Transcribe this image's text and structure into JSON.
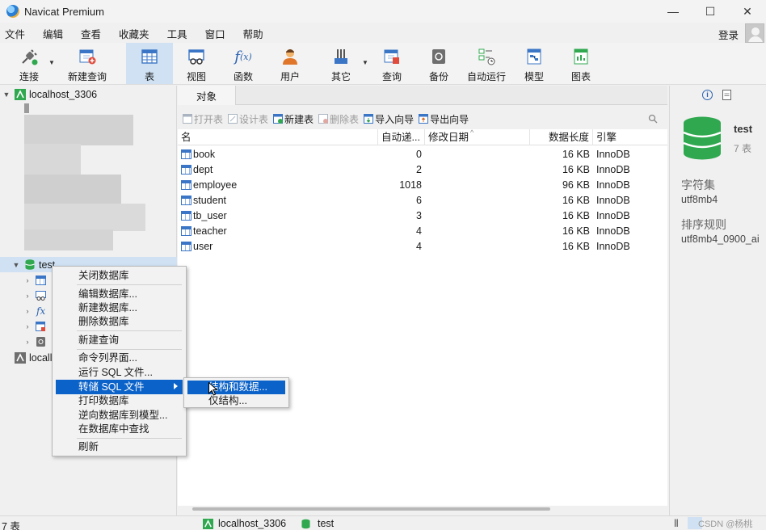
{
  "window": {
    "title": "Navicat Premium",
    "minimize": "—",
    "maximize": "☐",
    "close": "✕"
  },
  "menubar": {
    "items": [
      "文件",
      "编辑",
      "查看",
      "收藏夹",
      "工具",
      "窗口",
      "帮助"
    ],
    "login": "登录"
  },
  "toolbar": {
    "connect": "连接",
    "new_query": "新建查询",
    "table": "表",
    "view": "视图",
    "function": "函数",
    "user": "用户",
    "other": "其它",
    "query": "查询",
    "backup": "备份",
    "auto_run": "自动运行",
    "model": "模型",
    "chart": "图表"
  },
  "tree": {
    "connection1": "localhost_3306",
    "db_test": "test",
    "connection2_partial": "locall"
  },
  "tabs": {
    "objects": "对象"
  },
  "object_toolbar": {
    "open_table": "打开表",
    "design_table": "设计表",
    "new_table": "新建表",
    "delete_table": "删除表",
    "import_wizard": "导入向导",
    "export_wizard": "导出向导"
  },
  "grid": {
    "columns": [
      "名",
      "自动递...",
      "修改日期",
      "数据长度",
      "引擎"
    ],
    "rows": [
      {
        "name": "book",
        "auto_inc": "0",
        "modified": "",
        "size": "16 KB",
        "engine": "InnoDB"
      },
      {
        "name": "dept",
        "auto_inc": "2",
        "modified": "",
        "size": "16 KB",
        "engine": "InnoDB"
      },
      {
        "name": "employee",
        "auto_inc": "1018",
        "modified": "",
        "size": "96 KB",
        "engine": "InnoDB"
      },
      {
        "name": "student",
        "auto_inc": "6",
        "modified": "",
        "size": "16 KB",
        "engine": "InnoDB"
      },
      {
        "name": "tb_user",
        "auto_inc": "3",
        "modified": "",
        "size": "16 KB",
        "engine": "InnoDB"
      },
      {
        "name": "teacher",
        "auto_inc": "4",
        "modified": "",
        "size": "16 KB",
        "engine": "InnoDB"
      },
      {
        "name": "user",
        "auto_inc": "4",
        "modified": "",
        "size": "16 KB",
        "engine": "InnoDB"
      }
    ]
  },
  "info_panel": {
    "db_name": "test",
    "table_count": "7 表",
    "charset_label": "字符集",
    "charset": "utf8mb4",
    "collation_label": "排序规则",
    "collation": "utf8mb4_0900_ai"
  },
  "context_menu": {
    "items": [
      "关闭数据库",
      "编辑数据库...",
      "新建数据库...",
      "删除数据库",
      "新建查询",
      "命令列界面...",
      "运行 SQL 文件...",
      "转储 SQL 文件",
      "打印数据库",
      "逆向数据库到模型...",
      "在数据库中查找",
      "刷新"
    ],
    "submenu": [
      "结构和数据...",
      "仅结构..."
    ]
  },
  "statusbar": {
    "count": "7 表",
    "connection": "localhost_3306",
    "database": "test",
    "watermark": "CSDN @杨桃"
  },
  "colors": {
    "accent": "#0b62c8",
    "selected": "#cfe1f3",
    "db_green": "#2fa84f"
  }
}
